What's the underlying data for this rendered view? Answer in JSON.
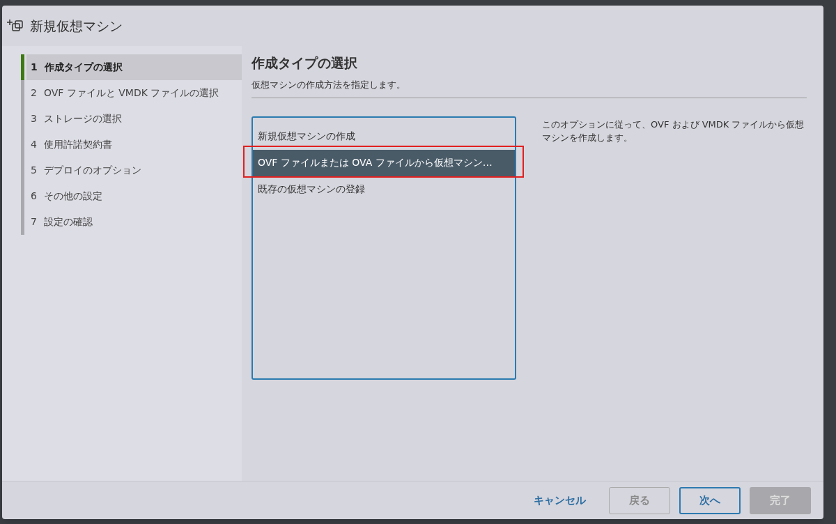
{
  "window": {
    "title": "新規仮想マシン"
  },
  "steps": [
    {
      "number": "1",
      "label": "作成タイプの選択",
      "selected": true
    },
    {
      "number": "2",
      "label": "OVF ファイルと VMDK ファイルの選択",
      "selected": false
    },
    {
      "number": "3",
      "label": "ストレージの選択",
      "selected": false
    },
    {
      "number": "4",
      "label": "使用許諾契約書",
      "selected": false
    },
    {
      "number": "5",
      "label": "デプロイのオプション",
      "selected": false
    },
    {
      "number": "6",
      "label": "その他の設定",
      "selected": false
    },
    {
      "number": "7",
      "label": "設定の確認",
      "selected": false
    }
  ],
  "page": {
    "heading": "作成タイプの選択",
    "subtitle": "仮想マシンの作成方法を指定します。"
  },
  "creation_types": [
    {
      "label": "新規仮想マシンの作成",
      "selected": false,
      "highlighted": false
    },
    {
      "label": "OVF ファイルまたは OVA ファイルから仮想マシン…",
      "selected": true,
      "highlighted": true
    },
    {
      "label": "既存の仮想マシンの登録",
      "selected": false,
      "highlighted": false
    }
  ],
  "description": "このオプションに従って、OVF および VMDK ファイルから仮想マシンを作成します。",
  "buttons": [
    {
      "kind": "link",
      "label": "キャンセル",
      "disabled": false
    },
    {
      "kind": "outline",
      "label": "戻る",
      "disabled": true
    },
    {
      "kind": "outline",
      "label": "次へ",
      "disabled": false
    },
    {
      "kind": "solid",
      "label": "完了",
      "disabled": true
    }
  ]
}
